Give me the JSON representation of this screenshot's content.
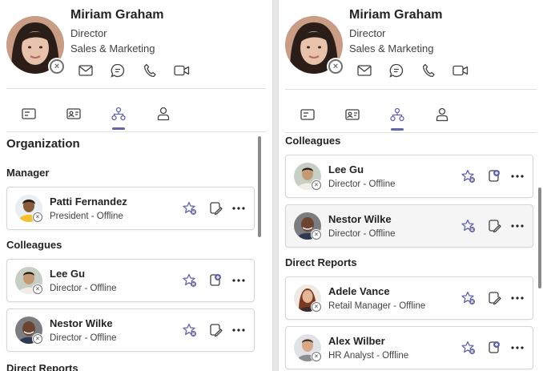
{
  "profile": {
    "name": "Miriam Graham",
    "title": "Director",
    "department": "Sales & Marketing",
    "actions": [
      "mail-icon",
      "chat-icon",
      "phone-icon",
      "video-icon"
    ]
  },
  "tabs": [
    {
      "icon": "overview-icon",
      "active": false
    },
    {
      "icon": "contact-card-icon",
      "active": false
    },
    {
      "icon": "org-chart-icon",
      "active": true
    },
    {
      "icon": "person-icon",
      "active": false
    }
  ],
  "left": {
    "heading": "Organization",
    "manager_label": "Manager",
    "colleagues_label": "Colleagues",
    "cut_label": "Direct Reports",
    "manager": {
      "name": "Patti Fernandez",
      "status": "President - Offline"
    },
    "colleagues": [
      {
        "name": "Lee Gu",
        "status": "Director - Offline"
      },
      {
        "name": "Nestor Wilke",
        "status": "Director - Offline"
      }
    ]
  },
  "right": {
    "colleagues_label": "Colleagues",
    "direct_reports_label": "Direct Reports",
    "colleagues": [
      {
        "name": "Lee Gu",
        "status": "Director - Offline"
      },
      {
        "name": "Nestor Wilke",
        "status": "Director - Offline"
      }
    ],
    "direct_reports": [
      {
        "name": "Adele Vance",
        "status": "Retail Manager - Offline"
      },
      {
        "name": "Alex Wilber",
        "status": "HR Analyst - Offline"
      }
    ]
  },
  "colors": {
    "accent": "#6264a7",
    "text": "#242424",
    "secondary_text": "#424242",
    "offline": "#707070"
  }
}
